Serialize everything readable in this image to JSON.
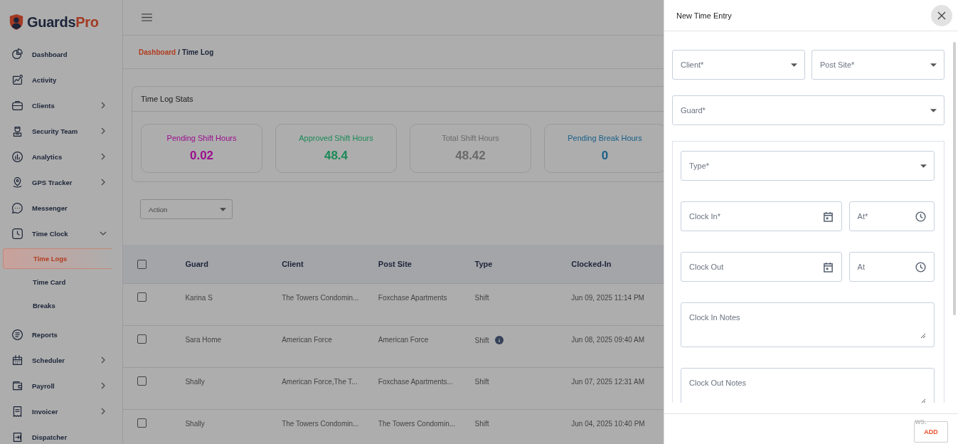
{
  "brand": {
    "primary": "Guards",
    "accent": "Pro"
  },
  "sidebar": {
    "items": [
      {
        "label": "Dashboard",
        "expandable": false
      },
      {
        "label": "Activity",
        "expandable": false
      },
      {
        "label": "Clients",
        "expandable": true,
        "expanded": false
      },
      {
        "label": "Security Team",
        "expandable": true,
        "expanded": false
      },
      {
        "label": "Analytics",
        "expandable": true,
        "expanded": false
      },
      {
        "label": "GPS Tracker",
        "expandable": true,
        "expanded": false
      },
      {
        "label": "Messenger",
        "expandable": false
      },
      {
        "label": "Time Clock",
        "expandable": true,
        "expanded": true,
        "children": [
          {
            "label": "Time Logs",
            "selected": true
          },
          {
            "label": "Time Card",
            "selected": false
          },
          {
            "label": "Breaks",
            "selected": false
          }
        ]
      },
      {
        "label": "Reports",
        "expandable": false
      },
      {
        "label": "Scheduler",
        "expandable": true,
        "expanded": false
      },
      {
        "label": "Payroll",
        "expandable": true,
        "expanded": false
      },
      {
        "label": "Invoicer",
        "expandable": true,
        "expanded": false
      },
      {
        "label": "Dispatcher",
        "expandable": false
      }
    ]
  },
  "breadcrumb": {
    "items": [
      {
        "label": "Dashboard",
        "link": true
      },
      {
        "label": "Time Log",
        "link": false
      }
    ],
    "separator": "/"
  },
  "stats": {
    "title": "Time Log Stats",
    "cards": [
      {
        "label": "Pending Shift Hours",
        "value": "0.02",
        "color": "#9c0e8e"
      },
      {
        "label": "Approved Shift Hours",
        "value": "48.4",
        "color": "#1c8a58"
      },
      {
        "label": "Total Shift Hours",
        "value": "48.42",
        "color": "#6a6a6a"
      },
      {
        "label": "Pending Break Hours",
        "value": "0",
        "color": "#185f88"
      }
    ]
  },
  "action_select": {
    "placeholder": "Action"
  },
  "table": {
    "all_checked": false,
    "columns": [
      "Guard",
      "Client",
      "Post Site",
      "Type",
      "Clocked-In"
    ],
    "rows": [
      {
        "checked": false,
        "info": false,
        "cells": [
          "Karina S",
          "The Towers Condomin...",
          "Foxchase Apartments",
          "Shift",
          "Jun 09, 2025 11:14 PM"
        ]
      },
      {
        "checked": false,
        "info": true,
        "cells": [
          "Sara Home",
          "American Force",
          "American Force",
          "Shift",
          "Jun 08, 2025 09:40 AM"
        ]
      },
      {
        "checked": false,
        "info": false,
        "cells": [
          "Shally",
          "American Force,The T...",
          "Foxchase Apartments...",
          "Shift",
          "Jun 07, 2025 12:31 AM"
        ]
      },
      {
        "checked": false,
        "info": false,
        "cells": [
          "Shally",
          "The Towers Condomin...",
          "The Towers Condomin...",
          "Shift",
          "Jun 04, 2025 10:40 PM"
        ]
      }
    ]
  },
  "drawer": {
    "title": "New Time Entry",
    "top_fields": [
      [
        {
          "kind": "select",
          "placeholder": "Client*"
        },
        {
          "kind": "select",
          "placeholder": "Post Site*"
        }
      ],
      [
        {
          "kind": "select",
          "placeholder": "Guard*"
        }
      ]
    ],
    "entry_fields": [
      [
        {
          "kind": "select",
          "placeholder": "Type*"
        }
      ],
      [
        {
          "kind": "date",
          "placeholder": "Clock In*"
        },
        {
          "kind": "time",
          "placeholder": "At*"
        }
      ],
      [
        {
          "kind": "date",
          "placeholder": "Clock Out"
        },
        {
          "kind": "time",
          "placeholder": "At"
        }
      ],
      [
        {
          "kind": "textarea",
          "placeholder": "Clock In Notes"
        }
      ],
      [
        {
          "kind": "textarea",
          "placeholder": "Clock Out Notes"
        }
      ]
    ],
    "footer_text": "ws.",
    "submit": "ADD"
  }
}
